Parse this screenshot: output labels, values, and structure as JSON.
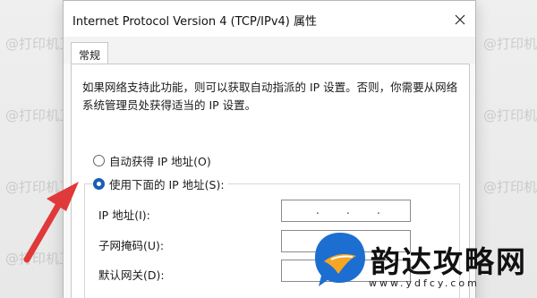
{
  "dialog": {
    "title": "Internet Protocol Version 4 (TCP/IPv4) 属性",
    "tab_general": "常规",
    "description": "如果网络支持此功能，则可以获取自动指派的 IP 设置。否则，你需要从网络系统管理员处获得适当的 IP 设置。",
    "radio_auto_ip": "自动获得 IP 地址(O)",
    "radio_manual_ip": "使用下面的 IP 地址(S):",
    "manual_ip_selected": true,
    "ip_address_label": "IP 地址(I):",
    "subnet_mask_label": "子网掩码(U):",
    "default_gateway_label": "默认网关(D):",
    "ip_address_value": ". . ."
  },
  "watermark": {
    "text": "@打印机卫士"
  },
  "logo": {
    "name": "韵达攻略网",
    "url": "www.ydfcy.com"
  },
  "colors": {
    "accent": "#1a5fb4",
    "arrow": "#e0393a",
    "logo_bubble": "#1c6fd1",
    "logo_wing": "#f5a623"
  }
}
